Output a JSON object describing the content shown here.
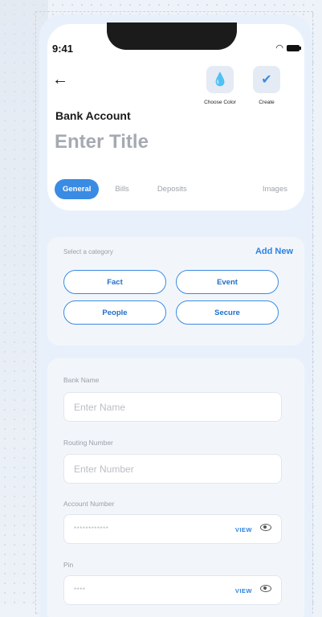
{
  "status": {
    "time": "9:41"
  },
  "header": {
    "back_icon": "arrow-left-icon",
    "actions": [
      {
        "label": "Choose Color",
        "icon": "droplet-icon",
        "glyph": "💧"
      },
      {
        "label": "Create",
        "icon": "check-icon",
        "glyph": "✔"
      }
    ],
    "section_title": "Bank Account",
    "title_placeholder": "Enter Title"
  },
  "tabs": [
    {
      "label": "General",
      "active": true
    },
    {
      "label": "Bills"
    },
    {
      "label": "Deposits"
    },
    {
      "label": "Images"
    }
  ],
  "category": {
    "label": "Select a category",
    "add_new": "Add New",
    "options": [
      "Fact",
      "Event",
      "People",
      "Secure"
    ]
  },
  "form": {
    "bank_name_label": "Bank Name",
    "bank_name_placeholder": "Enter Name",
    "routing_label": "Routing Number",
    "routing_placeholder": "Enter Number",
    "account_label": "Account Number",
    "account_masked": "************",
    "pin_label": "Pin",
    "pin_masked": "****",
    "view_label": "VIEW",
    "eye_icon": "eye-icon"
  },
  "colors": {
    "accent": "#3a8be3",
    "link": "#2e82e0"
  }
}
